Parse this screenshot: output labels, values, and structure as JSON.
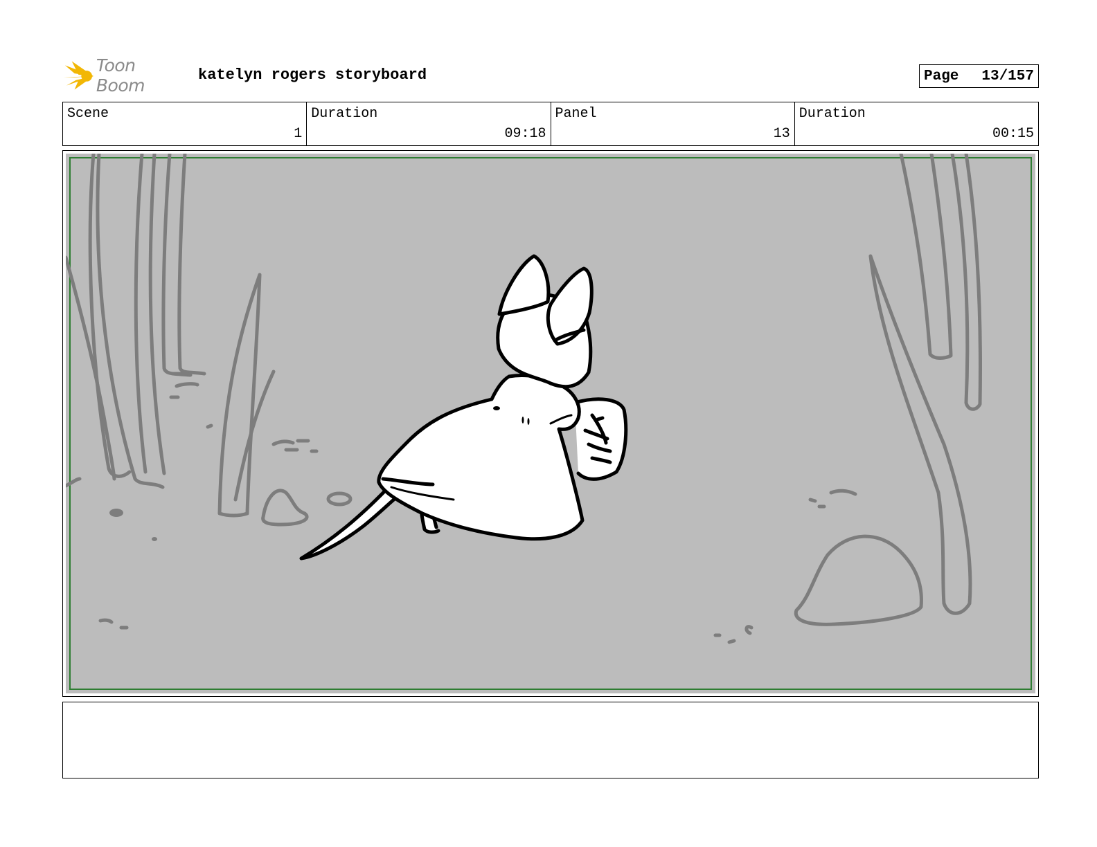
{
  "header": {
    "logo_text": "Toon Boom",
    "title": "katelyn rogers storyboard",
    "page_label": "Page",
    "page_value": "13/157"
  },
  "info": {
    "scene_label": "Scene",
    "scene_value": "1",
    "scene_duration_label": "Duration",
    "scene_duration_value": "09:18",
    "panel_label": "Panel",
    "panel_value": "13",
    "panel_duration_label": "Duration",
    "panel_duration_value": "00:15"
  },
  "colors": {
    "logo_accent": "#f2b705",
    "safe_frame": "#2e7d32",
    "panel_bg": "#bcbcbc",
    "background_lines": "#7d7d7d",
    "character_lines": "#000000"
  },
  "icons": {
    "logo": "toon-boom-starburst-icon"
  },
  "notes": {
    "text": ""
  }
}
